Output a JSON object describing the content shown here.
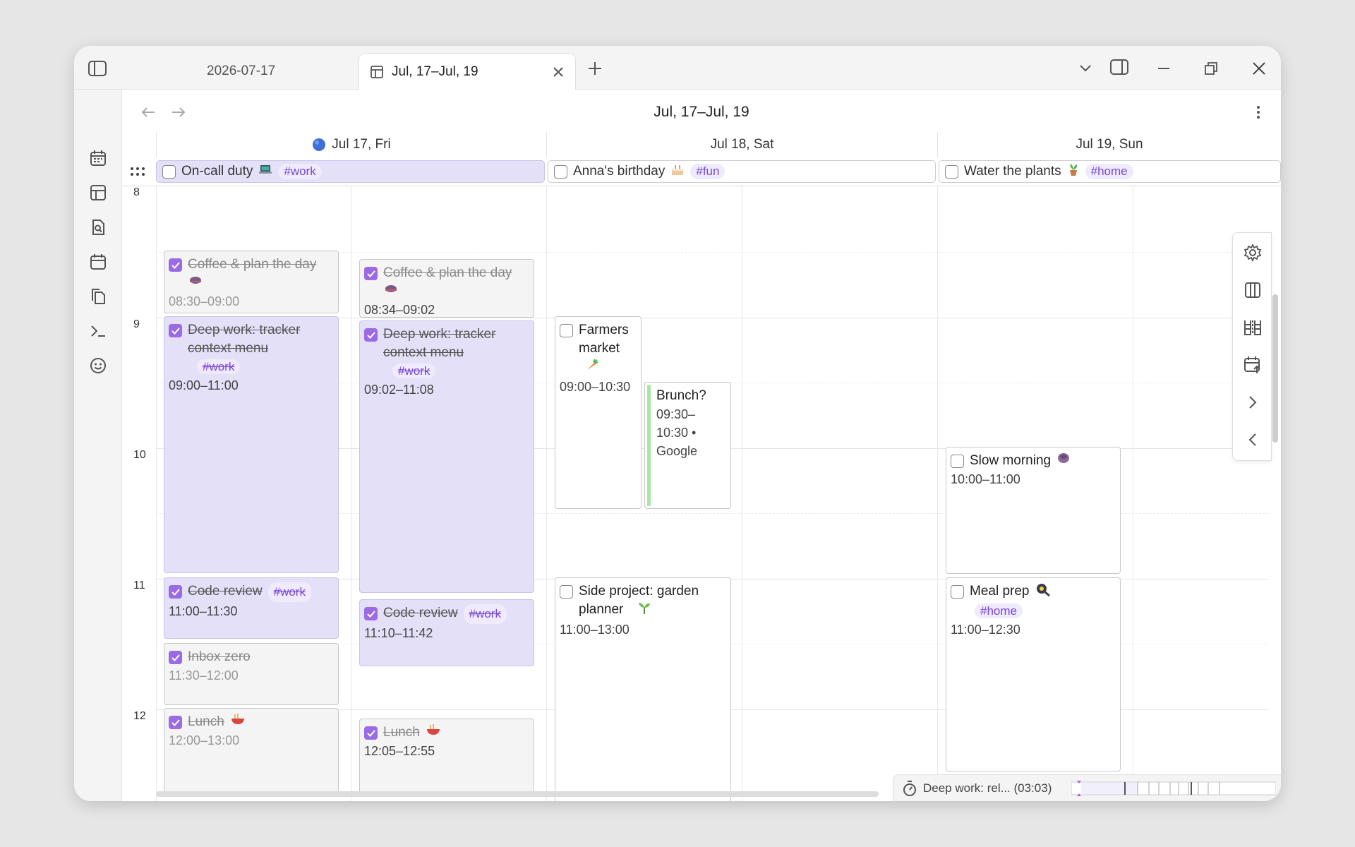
{
  "tabs": [
    {
      "label": "2026-07-17",
      "active": false
    },
    {
      "label": "Jul, 17–Jul, 19",
      "active": true
    }
  ],
  "view_title": "Jul, 17–Jul, 19",
  "days": [
    {
      "label": "Jul 17, Fri",
      "today": true
    },
    {
      "label": "Jul 18, Sat",
      "today": false
    },
    {
      "label": "Jul 19, Sun",
      "today": false
    }
  ],
  "all_day": [
    {
      "title": "On-call duty",
      "tag": "#work",
      "emoji": "laptop"
    },
    {
      "title": "Anna's birthday",
      "tag": "#fun",
      "emoji": "cake"
    },
    {
      "title": "Water the plants",
      "tag": "#home",
      "emoji": "potted-plant"
    }
  ],
  "hours": [
    "8",
    "9",
    "10",
    "11",
    "12"
  ],
  "events": {
    "coffee1": {
      "title": "Coffee & plan the day",
      "time": "08:30–09:00"
    },
    "coffee2": {
      "title": "Coffee & plan the day",
      "time": "08:34–09:02"
    },
    "deep1": {
      "title": "Deep work: tracker context menu",
      "tag": "#work",
      "time": "09:00–11:00"
    },
    "deep2": {
      "title": "Deep work: tracker context menu",
      "tag": "#work",
      "time": "09:02–11:08"
    },
    "review1": {
      "title": "Code review",
      "tag": "#work",
      "time": "11:00–11:30"
    },
    "review2": {
      "title": "Code review",
      "tag": "#work",
      "time": "11:10–11:42"
    },
    "inbox": {
      "title": "Inbox zero",
      "time": "11:30–12:00"
    },
    "lunch1": {
      "title": "Lunch",
      "time": "12:00–13:00"
    },
    "lunch2": {
      "title": "Lunch",
      "time": "12:05–12:55"
    },
    "farmers": {
      "title": "Farmers market",
      "time": "09:00–10:30"
    },
    "brunch": {
      "title": "Brunch?",
      "time": "09:30–10:30 • Google"
    },
    "garden": {
      "title": "Side project: garden planner",
      "time": "11:00–13:00"
    },
    "slow": {
      "title": "Slow morning",
      "time": "10:00–11:00"
    },
    "mealprep": {
      "title": "Meal prep",
      "tag": "#home",
      "time": "11:00–12:30"
    }
  },
  "status": {
    "timer_text": "Deep work: rel... (03:03)"
  },
  "colors": {
    "accent": "#9b6be6",
    "work_bg": "#e3e0f8",
    "tag_text": "#7a48d6",
    "ext_bar": "#a6e8a2"
  }
}
